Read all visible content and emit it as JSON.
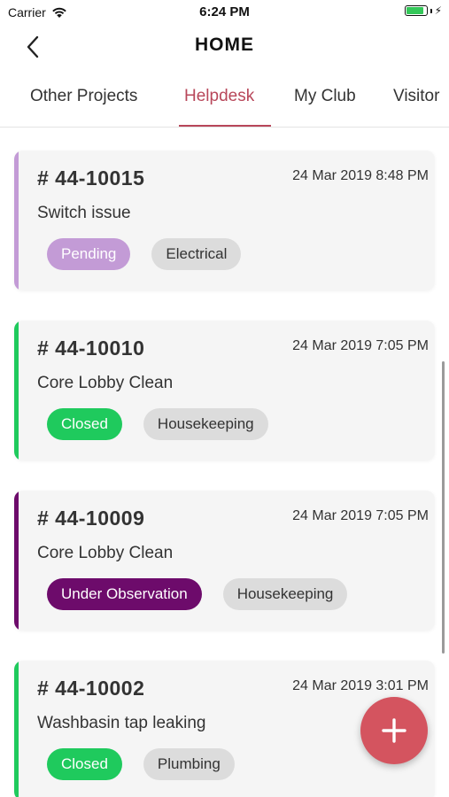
{
  "status_bar": {
    "carrier": "Carrier",
    "time": "6:24 PM",
    "battery_level": 0.9,
    "battery_color": "#34c759"
  },
  "nav": {
    "title": "HOME",
    "back_icon": "chevron-left-icon"
  },
  "tabs": [
    {
      "label": "Other Projects",
      "active": false
    },
    {
      "label": "Helpdesk",
      "active": true
    },
    {
      "label": "My Club",
      "active": false
    },
    {
      "label": "Visitor",
      "active": false
    }
  ],
  "accent_color": "#b8475a",
  "tickets": [
    {
      "id": "# 44-10015",
      "date": "24 Mar 2019 8:48 PM",
      "title": "Switch issue",
      "status": "Pending",
      "status_color": "#c39bd6",
      "category": "Electrical"
    },
    {
      "id": "# 44-10010",
      "date": "24 Mar 2019 7:05 PM",
      "title": "Core Lobby Clean",
      "status": "Closed",
      "status_color": "#1fca5d",
      "category": "Housekeeping"
    },
    {
      "id": "# 44-10009",
      "date": "24 Mar 2019 7:05 PM",
      "title": "Core Lobby Clean",
      "status": "Under Observation",
      "status_color": "#6d0b6b",
      "category": "Housekeeping"
    },
    {
      "id": "# 44-10002",
      "date": "24 Mar 2019 3:01 PM",
      "title": "Washbasin tap leaking",
      "status": "Closed",
      "status_color": "#1fca5d",
      "category": "Plumbing"
    }
  ],
  "fab": {
    "icon": "plus-icon",
    "color": "#d4545f"
  }
}
